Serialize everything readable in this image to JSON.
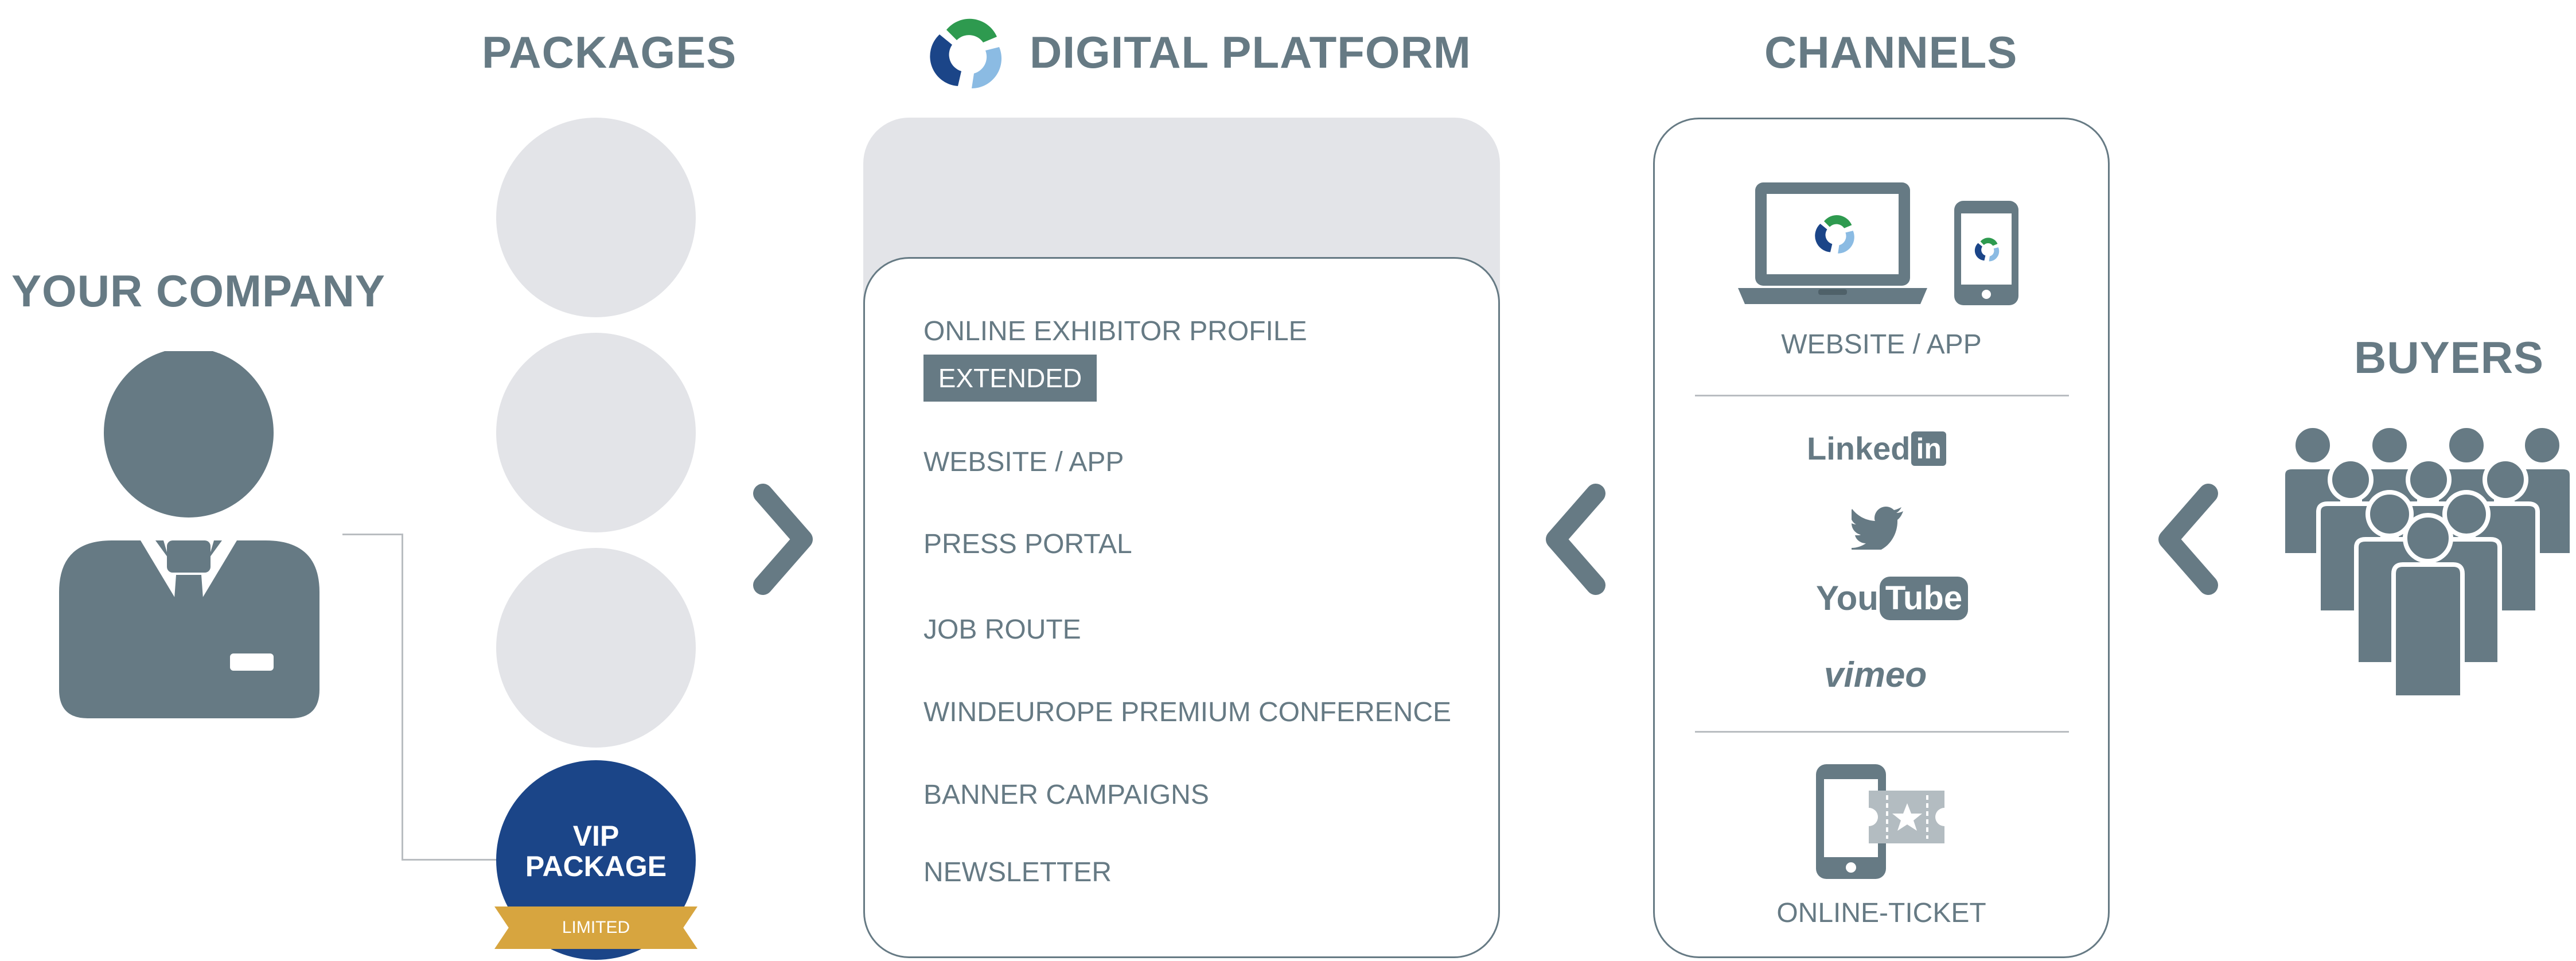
{
  "headings": {
    "packages": "PACKAGES",
    "digital_platform": "DIGITAL PLATFORM",
    "channels": "CHANNELS",
    "your_company": "YOUR COMPANY",
    "buyers": "BUYERS"
  },
  "vip_package": {
    "line1": "VIP",
    "line2": "PACKAGE",
    "ribbon": "LIMITED"
  },
  "platform_items": {
    "online_exhibitor_profile": "ONLINE EXHIBITOR PROFILE",
    "extended_badge": "EXTENDED",
    "website_app": "WEBSITE / APP",
    "press_portal": "PRESS PORTAL",
    "job_route": "JOB ROUTE",
    "premium_conference": "WINDEUROPE PREMIUM CONFERENCE",
    "banner_campaigns": "BANNER CAMPAIGNS",
    "newsletter": "NEWSLETTER"
  },
  "channels": {
    "website_app": "WEBSITE / APP",
    "online_ticket": "ONLINE-TICKET",
    "social": {
      "linkedin_text": "Linked",
      "linkedin_badge": "in",
      "youtube_text": "You",
      "youtube_badge": "Tube",
      "vimeo": "vimeo"
    }
  },
  "icons": {
    "logo": "swirl-logo-icon",
    "person": "businessman-icon",
    "buyers": "crowd-icon",
    "laptop": "laptop-icon",
    "phone": "smartphone-icon",
    "twitter": "twitter-bird-icon",
    "ticket": "ticket-icon"
  },
  "colors": {
    "primary_gray": "#667a84",
    "light_gray": "#e3e4e8",
    "vip_blue": "#1b4588",
    "ribbon_gold": "#d7a53f",
    "logo_green": "#2e9a4f",
    "logo_blue": "#1b4588",
    "logo_light_blue": "#8bbbe3"
  }
}
